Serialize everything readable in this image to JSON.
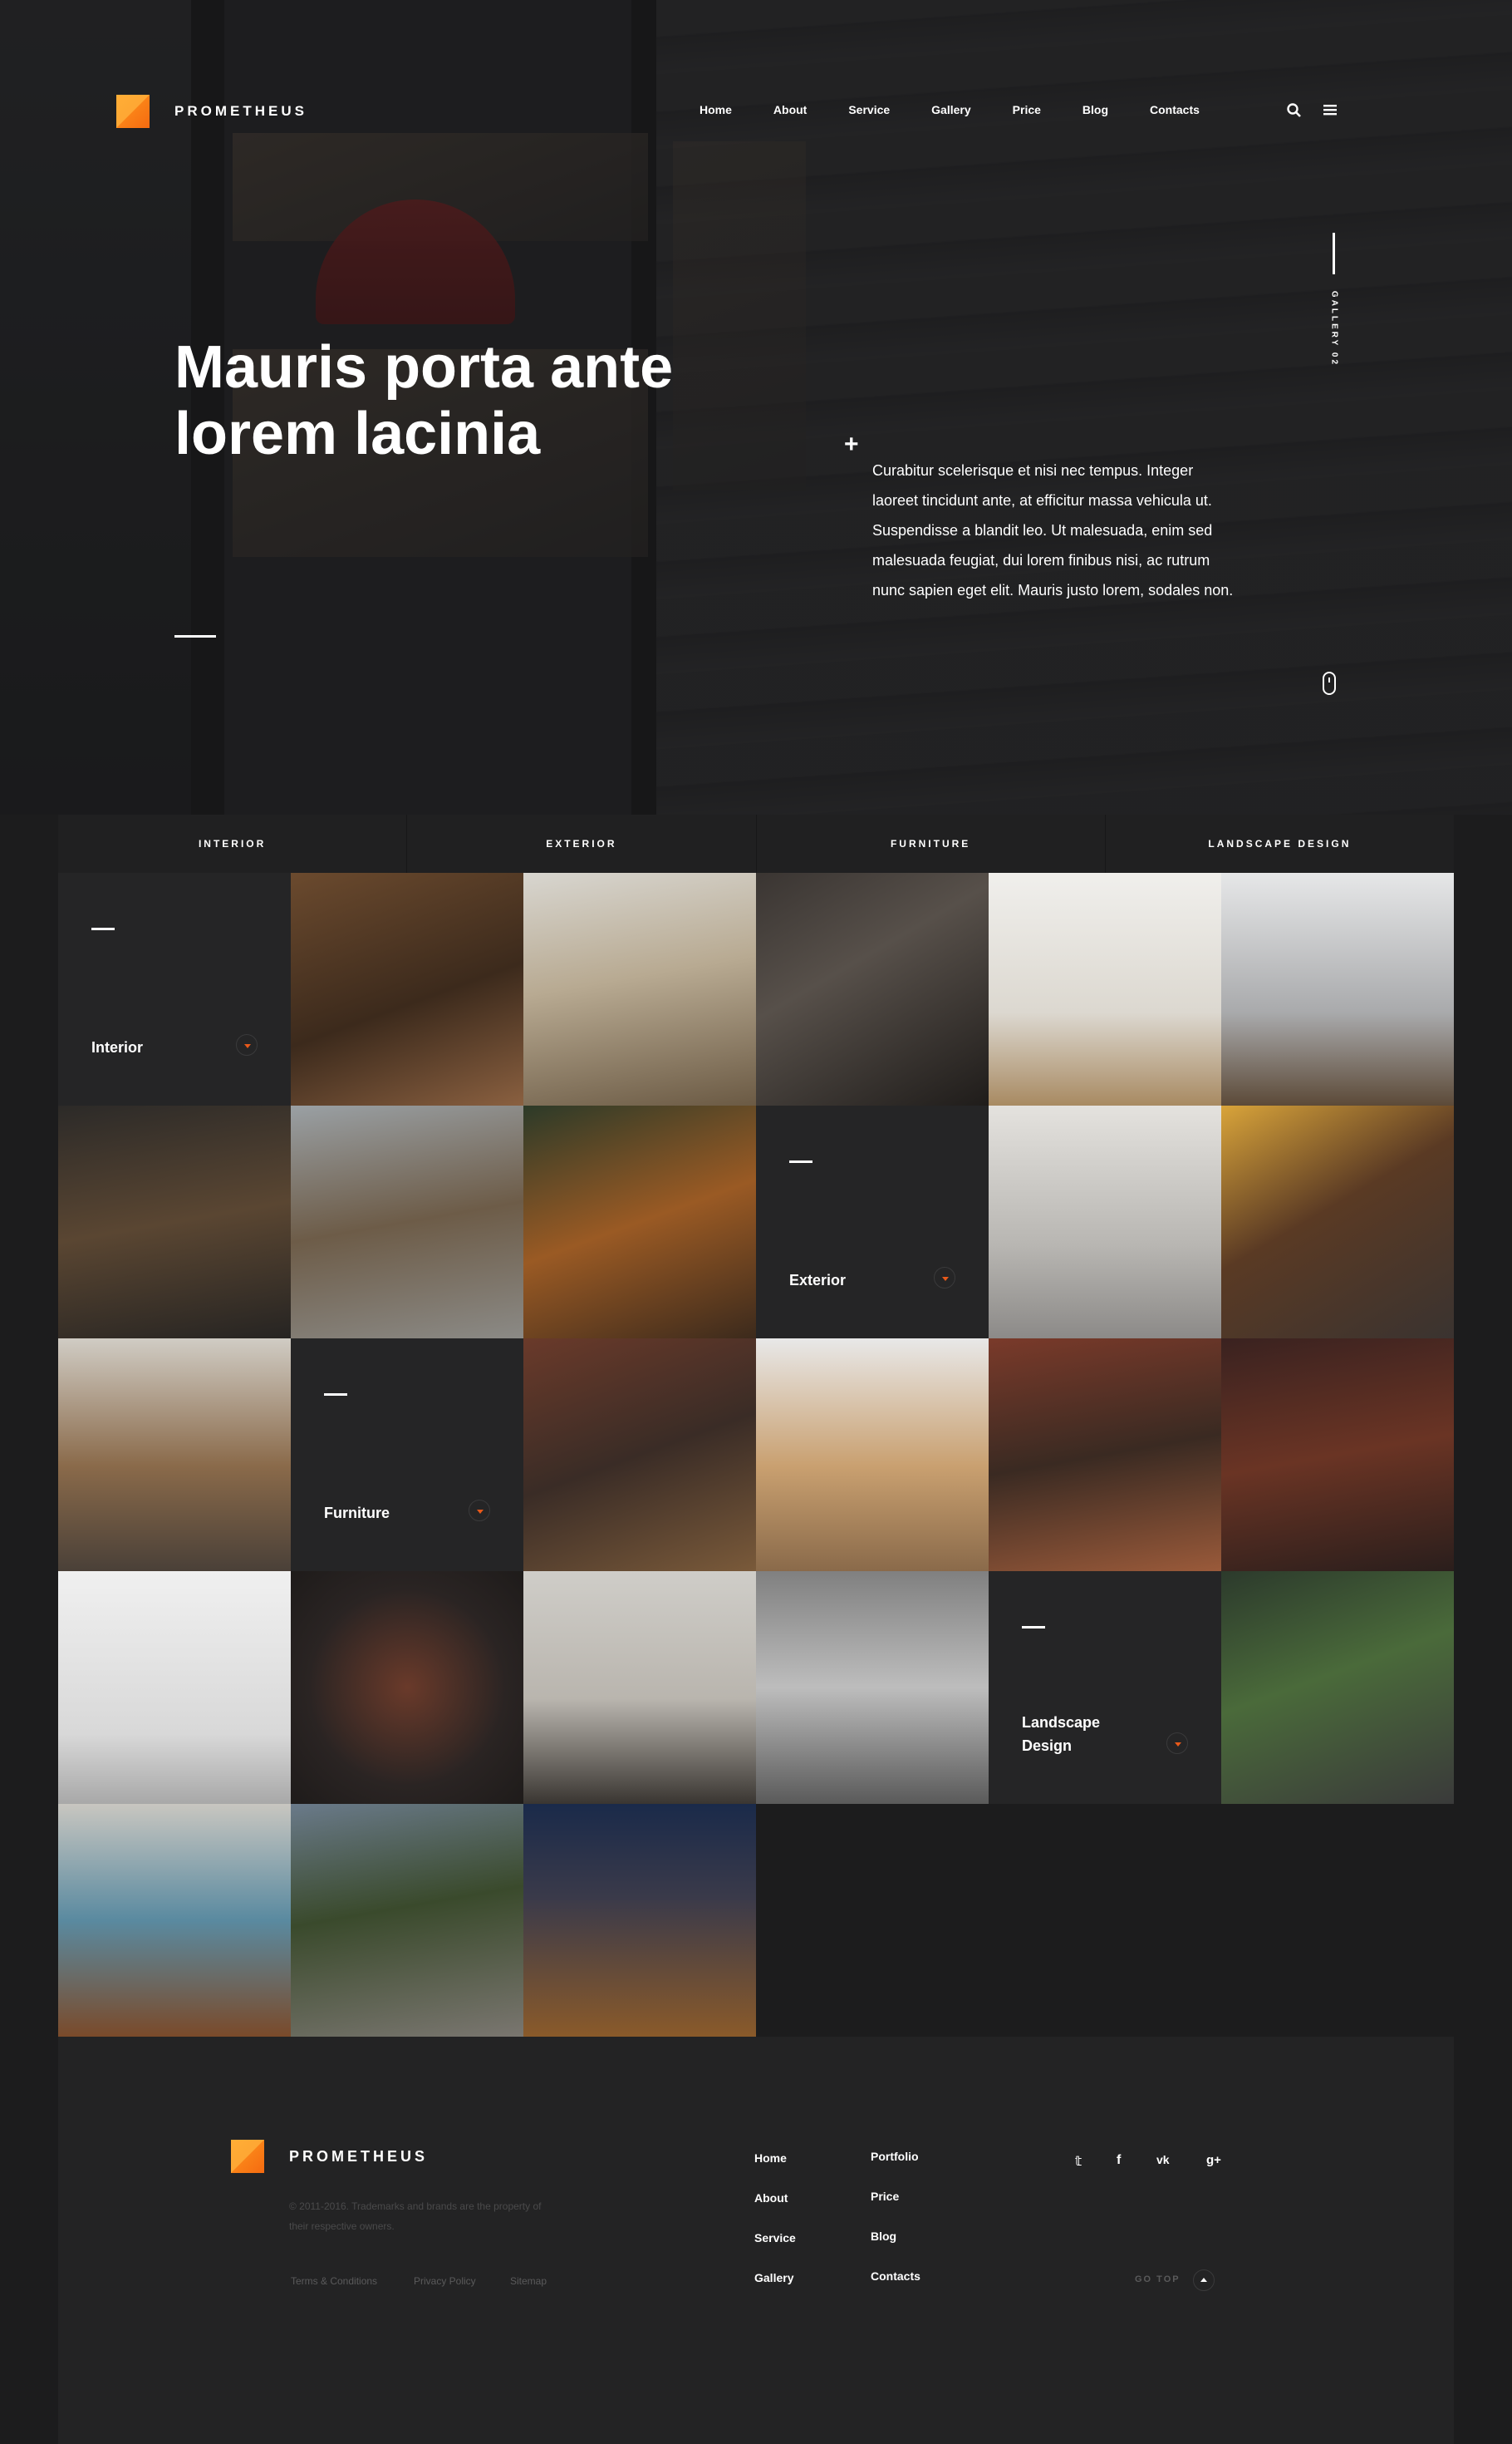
{
  "brand": {
    "name": "PROMETHEUS",
    "accent": "#f58a1a"
  },
  "nav": {
    "items": [
      "Home",
      "About",
      "Service",
      "Gallery",
      "Price",
      "Blog",
      "Contacts"
    ],
    "icons": [
      "search-icon",
      "menu-icon"
    ]
  },
  "hero": {
    "title_line1": "Mauris porta ante",
    "title_line2": "lorem lacinia",
    "side_tag": "GALLERY 02",
    "text": "Curabitur scelerisque et nisi nec tempus. Integer laoreet tincidunt ante, at efficitur massa vehicula ut. Suspendisse a blandit leo. Ut malesuada, enim sed malesuada feugiat, dui lorem finibus nisi, ac rutrum nunc sapien eget elit. Mauris justo lorem, sodales non."
  },
  "gallery": {
    "tabs": [
      "INTERIOR",
      "EXTERIOR",
      "FURNITURE",
      "LANDSCAPE DESIGN"
    ],
    "categories": {
      "interior": "Interior",
      "exterior": "Exterior",
      "furniture": "Furniture",
      "landscape_line1": "Landscape",
      "landscape_line2": "Design"
    }
  },
  "footer": {
    "brand": "PROMETHEUS",
    "copyright_line1": "© 2011-2016. Trademarks and brands are the property of",
    "copyright_line2": "their respective owners.",
    "legal": [
      "Terms & Conditions",
      "Privacy Policy",
      "Sitemap"
    ],
    "col1": [
      "Home",
      "About",
      "Service",
      "Gallery"
    ],
    "col2": [
      "Portfolio",
      "Price",
      "Blog",
      "Contacts"
    ],
    "social": [
      "twitter-icon",
      "facebook-icon",
      "vk-icon",
      "google-plus-icon"
    ],
    "social_glyphs": [
      "𝕥",
      "f",
      "vk",
      "g+"
    ],
    "go_top": "GO TOP"
  }
}
